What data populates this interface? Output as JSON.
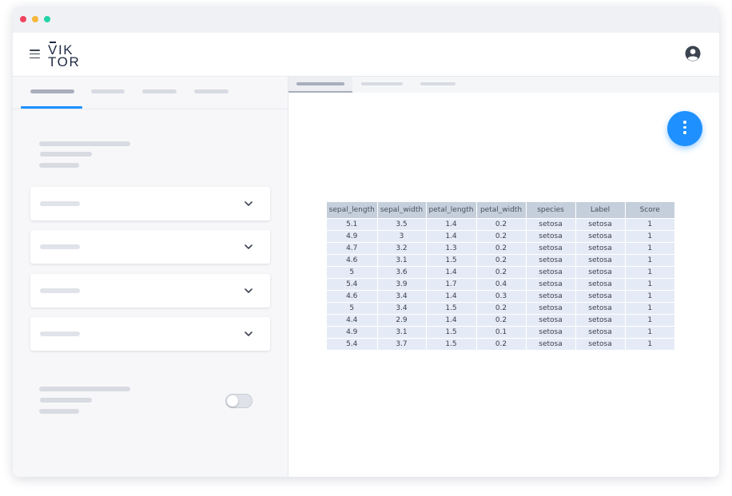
{
  "window": {
    "controls": [
      "close",
      "minimize",
      "maximize"
    ],
    "control_colors": [
      "#f0455f",
      "#f7b73b",
      "#22d3a6"
    ]
  },
  "app_bar": {
    "logo": {
      "line1": "VIK",
      "line2": "TOR"
    },
    "menu_icon": "hamburger-icon",
    "user_icon": "user-circle-icon"
  },
  "left_panel": {
    "tabs": 4,
    "active_tab_index": 0,
    "accordions": 4,
    "toggle": {
      "state": "off"
    }
  },
  "right_panel": {
    "tabs": 3,
    "active_tab_index": 0,
    "fab_icon": "more-vertical-icon",
    "accent_color": "#1e90ff",
    "table": {
      "columns": [
        "sepal_length",
        "sepal_width",
        "petal_length",
        "petal_width",
        "species",
        "Label",
        "Score"
      ],
      "rows": [
        [
          "5.1",
          "3.5",
          "1.4",
          "0.2",
          "setosa",
          "setosa",
          "1"
        ],
        [
          "4.9",
          "3",
          "1.4",
          "0.2",
          "setosa",
          "setosa",
          "1"
        ],
        [
          "4.7",
          "3.2",
          "1.3",
          "0.2",
          "setosa",
          "setosa",
          "1"
        ],
        [
          "4.6",
          "3.1",
          "1.5",
          "0.2",
          "setosa",
          "setosa",
          "1"
        ],
        [
          "5",
          "3.6",
          "1.4",
          "0.2",
          "setosa",
          "setosa",
          "1"
        ],
        [
          "5.4",
          "3.9",
          "1.7",
          "0.4",
          "setosa",
          "setosa",
          "1"
        ],
        [
          "4.6",
          "3.4",
          "1.4",
          "0.3",
          "setosa",
          "setosa",
          "1"
        ],
        [
          "5",
          "3.4",
          "1.5",
          "0.2",
          "setosa",
          "setosa",
          "1"
        ],
        [
          "4.4",
          "2.9",
          "1.4",
          "0.2",
          "setosa",
          "setosa",
          "1"
        ],
        [
          "4.9",
          "3.1",
          "1.5",
          "0.1",
          "setosa",
          "setosa",
          "1"
        ],
        [
          "5.4",
          "3.7",
          "1.5",
          "0.2",
          "setosa",
          "setosa",
          "1"
        ]
      ]
    }
  }
}
